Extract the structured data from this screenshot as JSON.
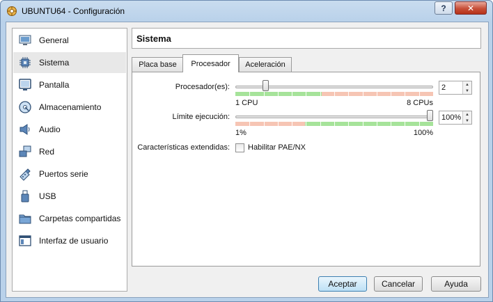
{
  "window": {
    "title": "UBUNTU64 - Configuración",
    "help_label": "?",
    "close_label": "✕"
  },
  "sidebar": {
    "items": [
      {
        "label": "General",
        "icon": "monitor-icon",
        "selected": false
      },
      {
        "label": "Sistema",
        "icon": "chip-icon",
        "selected": true
      },
      {
        "label": "Pantalla",
        "icon": "display-icon",
        "selected": false
      },
      {
        "label": "Almacenamiento",
        "icon": "disk-icon",
        "selected": false
      },
      {
        "label": "Audio",
        "icon": "speaker-icon",
        "selected": false
      },
      {
        "label": "Red",
        "icon": "network-icon",
        "selected": false
      },
      {
        "label": "Puertos serie",
        "icon": "serial-icon",
        "selected": false
      },
      {
        "label": "USB",
        "icon": "usb-icon",
        "selected": false
      },
      {
        "label": "Carpetas compartidas",
        "icon": "folder-icon",
        "selected": false
      },
      {
        "label": "Interfaz de usuario",
        "icon": "window-icon",
        "selected": false
      }
    ]
  },
  "header": {
    "title": "Sistema"
  },
  "tabs": [
    {
      "label": "Placa base",
      "active": false
    },
    {
      "label": "Procesador",
      "active": true
    },
    {
      "label": "Aceleración",
      "active": false
    }
  ],
  "processor": {
    "cpu_label": "Procesador(es):",
    "cpu_value": "2",
    "cpu_min_label": "1 CPU",
    "cpu_max_label": "8 CPUs",
    "cpu_level": 0.143,
    "exec_label": "Límite ejecución:",
    "exec_value": "100%",
    "exec_min_label": "1%",
    "exec_max_label": "100%",
    "exec_level": 1.0,
    "ext_label": "Características extendidas:",
    "pae_label": "Habilitar PAE/NX",
    "pae_checked": false
  },
  "buttons": {
    "ok": "Aceptar",
    "cancel": "Cancelar",
    "help": "Ayuda"
  },
  "colors": {
    "zone_ok": "#a6e39a",
    "zone_warn": "#f6c5b4",
    "title_bg": "#b9d1ea"
  }
}
